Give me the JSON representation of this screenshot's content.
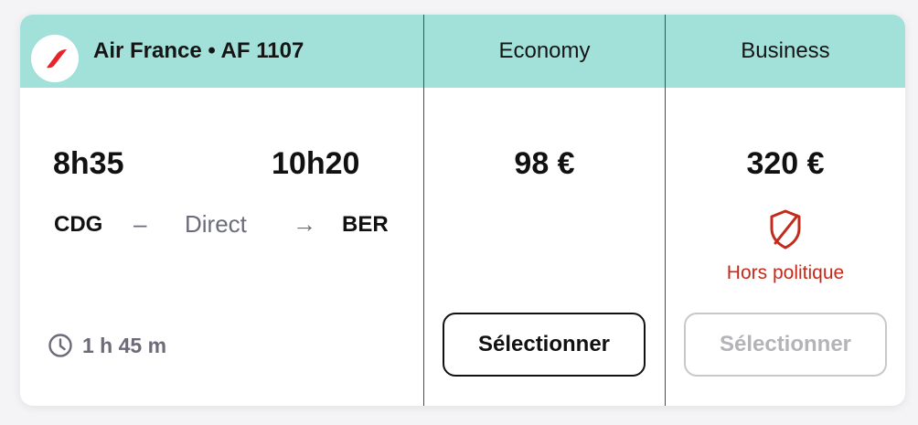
{
  "flight": {
    "airline_title": "Air France • AF 1107",
    "logo_icon": "air-france-logo",
    "departure_time": "8h35",
    "arrival_time": "10h20",
    "origin": "CDG",
    "destination": "BER",
    "dash": "–",
    "stop_type": "Direct",
    "arrow": "→",
    "duration": "1 h 45 m",
    "duration_icon": "clock-icon"
  },
  "fares": [
    {
      "cabin": "Economy",
      "price": "98 €",
      "select_label": "Sélectionner",
      "enabled": true
    },
    {
      "cabin": "Business",
      "price": "320 €",
      "select_label": "Sélectionner",
      "enabled": false,
      "policy_status": "Hors politique",
      "policy_icon": "shield-off-icon"
    }
  ],
  "colors": {
    "header_bg": "#a2e1d9",
    "policy_red": "#c42a1b",
    "brand_red": "#e8242b",
    "muted_text": "#6b6b7a"
  }
}
